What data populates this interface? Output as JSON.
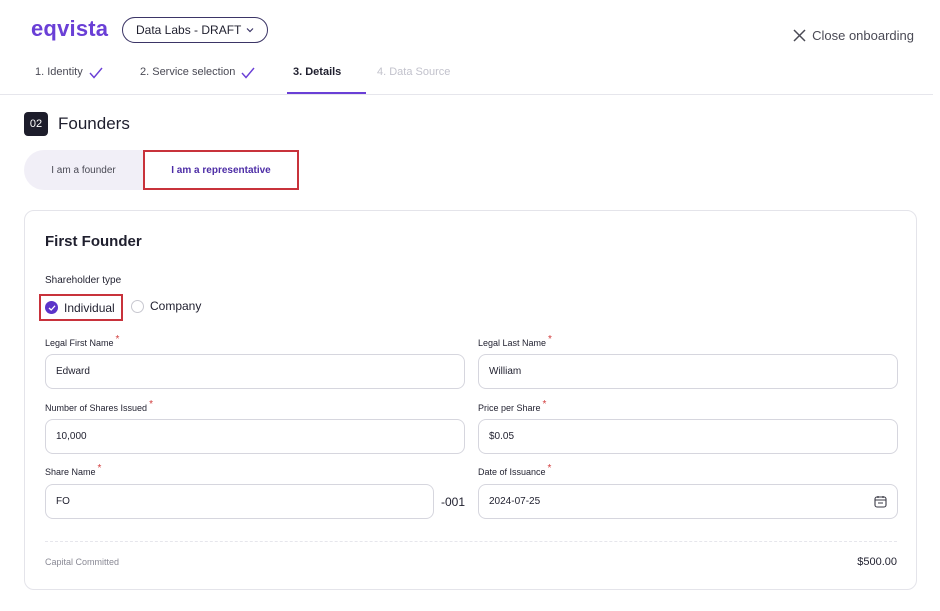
{
  "header": {
    "logo": "eqvista",
    "company_select": "Data Labs - DRAFT",
    "close_label": "Close onboarding"
  },
  "steps": [
    {
      "label": "1. Identity",
      "state": "done"
    },
    {
      "label": "2. Service selection",
      "state": "done"
    },
    {
      "label": "3. Details",
      "state": "active"
    },
    {
      "label": "4. Data Source",
      "state": "upcoming"
    }
  ],
  "section": {
    "number": "02",
    "title": "Founders"
  },
  "toggle": {
    "option_founder": "I am a founder",
    "option_representative": "I am a representative",
    "selected": "I am a representative"
  },
  "card": {
    "title": "First Founder",
    "shareholder_type_label": "Shareholder type",
    "options": {
      "individual": "Individual",
      "company": "Company"
    },
    "selected_type": "Individual",
    "fields": {
      "first_name": {
        "label": "Legal First Name",
        "value": "Edward"
      },
      "last_name": {
        "label": "Legal Last Name",
        "value": "William"
      },
      "shares": {
        "label": "Number of Shares Issued",
        "value": "10,000"
      },
      "price": {
        "label": "Price per Share",
        "value": "$0.05"
      },
      "share_name": {
        "label": "Share Name",
        "value": "FO",
        "suffix": "-001"
      },
      "issuance_date": {
        "label": "Date of Issuance",
        "value": "2024-07-25"
      }
    },
    "required_mark": "*",
    "capital_label": "Capital Committed",
    "capital_value": "$500.00"
  },
  "colors": {
    "brand": "#6a3fd6",
    "highlight": "#c8323b",
    "required": "#d13b3b"
  }
}
